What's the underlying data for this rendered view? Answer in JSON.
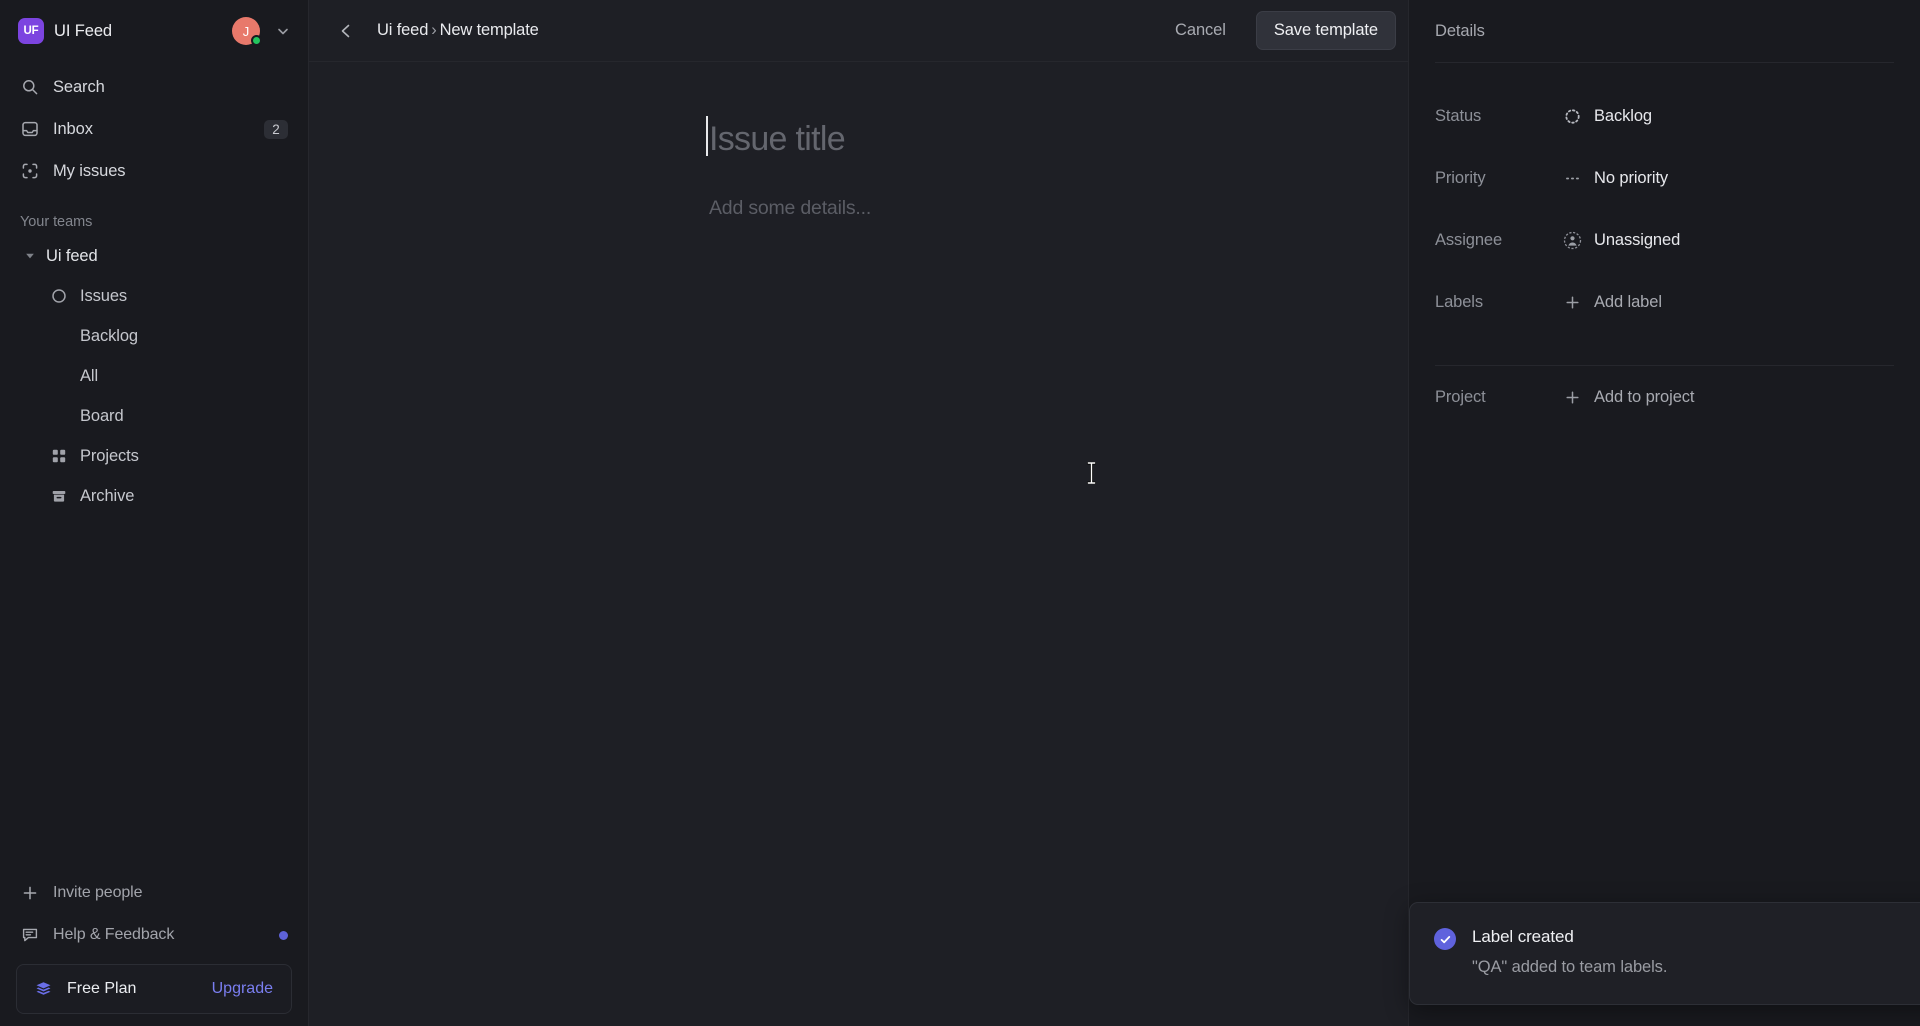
{
  "workspace": {
    "logo_initials": "UF",
    "name": "UI Feed",
    "avatar_initial": "J",
    "accent": "#7c44e0",
    "avatar_color": "#e8796b",
    "presence_color": "#23c55e"
  },
  "sidebar": {
    "nav": [
      {
        "label": "Search",
        "icon": "search-icon",
        "badge": ""
      },
      {
        "label": "Inbox",
        "icon": "inbox-icon",
        "badge": "2"
      },
      {
        "label": "My issues",
        "icon": "my-issues-icon",
        "badge": ""
      }
    ],
    "section_title": "Your teams",
    "team": {
      "label": "Ui feed",
      "expanded": true
    },
    "team_items": [
      {
        "label": "Issues",
        "icon": "circle-icon",
        "indented": false
      },
      {
        "label": "Backlog",
        "icon": "",
        "indented": true
      },
      {
        "label": "All",
        "icon": "",
        "indented": true
      },
      {
        "label": "Board",
        "icon": "",
        "indented": true
      },
      {
        "label": "Projects",
        "icon": "projects-grid-icon",
        "indented": false
      },
      {
        "label": "Archive",
        "icon": "archive-icon",
        "indented": false
      }
    ],
    "footer": [
      {
        "label": "Invite people",
        "icon": "plus-icon",
        "dot": false
      },
      {
        "label": "Help & Feedback",
        "icon": "feedback-icon",
        "dot": true
      }
    ],
    "plan": {
      "name": "Free Plan",
      "upgrade_label": "Upgrade",
      "icon": "layers-icon",
      "upgrade_color": "#7a7ef0"
    }
  },
  "topbar": {
    "back_icon": "chevron-left-icon",
    "breadcrumb_team": "Ui feed",
    "breadcrumb_sep": "›",
    "breadcrumb_page": "New template",
    "cancel_label": "Cancel",
    "save_label": "Save template"
  },
  "editor": {
    "title_value": "",
    "title_placeholder": "Issue title",
    "description_value": "",
    "description_placeholder": "Add some details...",
    "cursor": "i-beam"
  },
  "details": {
    "header": "Details",
    "rows": [
      {
        "label": "Status",
        "value": "Backlog",
        "icon": "backlog-dashed-circle-icon",
        "muted": false
      },
      {
        "label": "Priority",
        "value": "No priority",
        "icon": "no-priority-dots-icon",
        "muted": false
      },
      {
        "label": "Assignee",
        "value": "Unassigned",
        "icon": "unassigned-avatar-icon",
        "muted": false
      },
      {
        "label": "Labels",
        "value": "Add label",
        "icon": "plus-icon",
        "muted": true
      }
    ],
    "project_row": {
      "label": "Project",
      "value": "Add to project",
      "icon": "plus-icon"
    }
  },
  "toast": {
    "icon": "check-circle-icon",
    "title": "Label created",
    "message": "\"QA\" added to team labels.",
    "close_icon": "close-icon",
    "accent": "#5f62dd"
  }
}
